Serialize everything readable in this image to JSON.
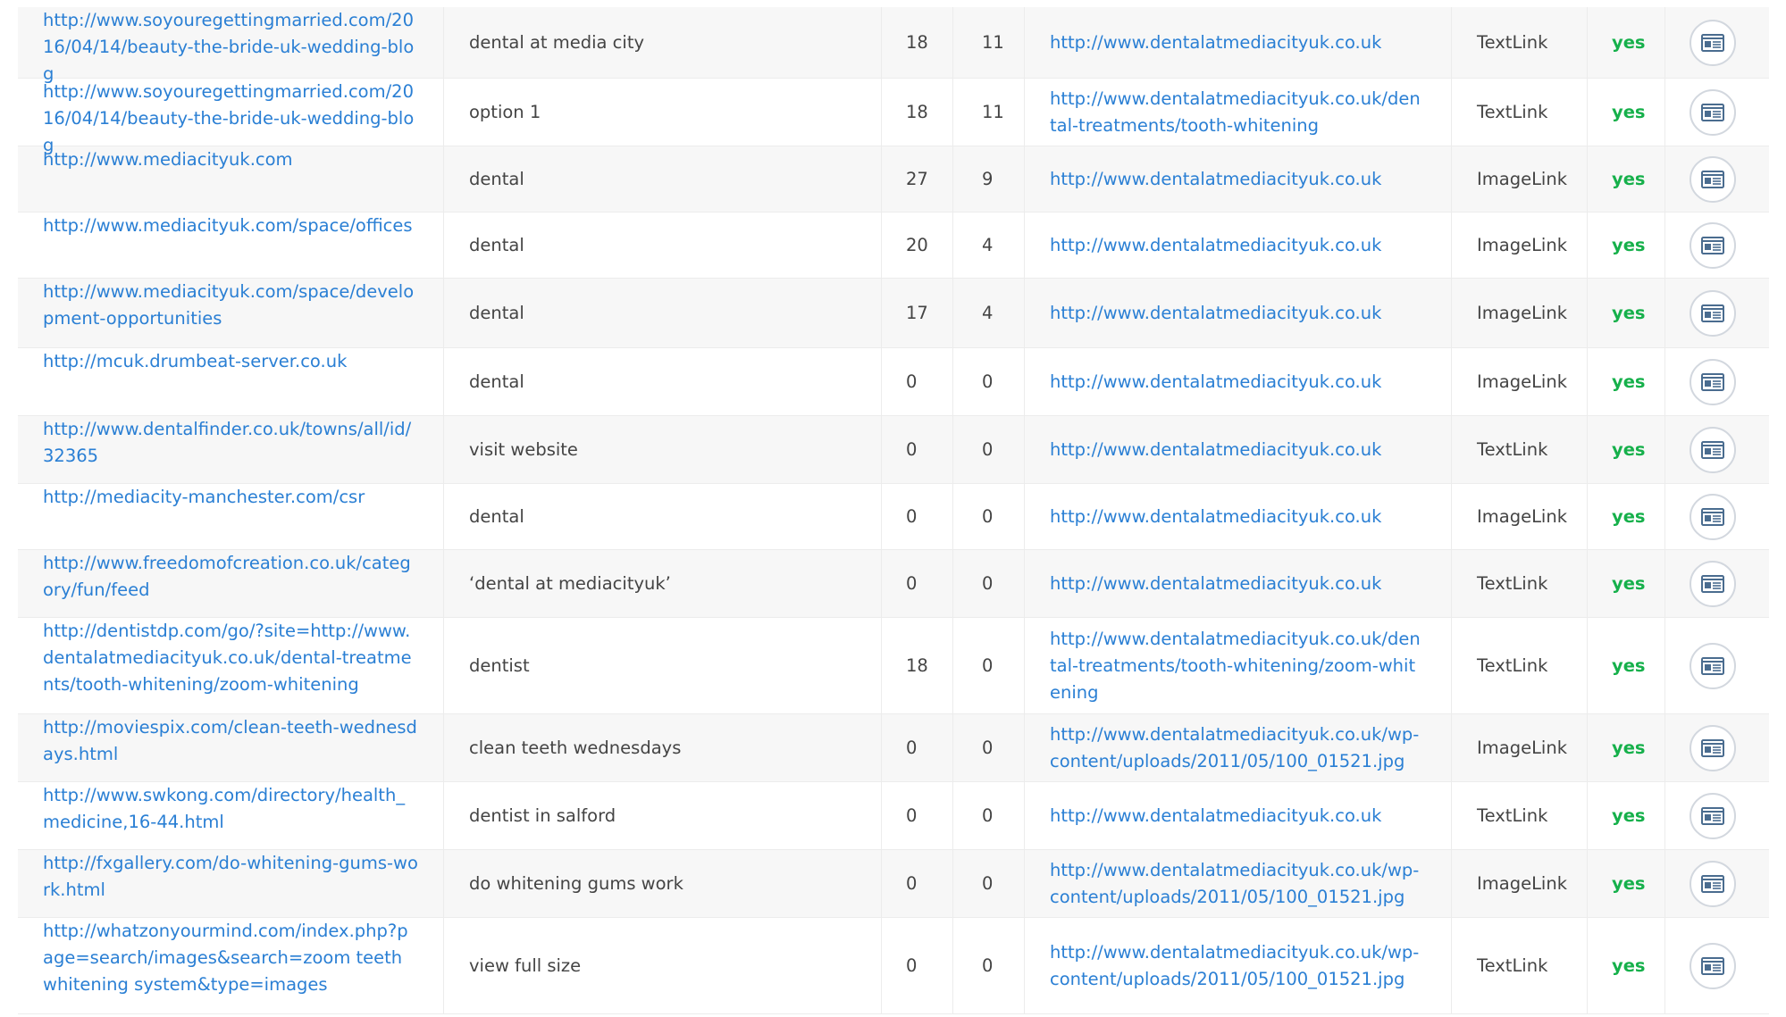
{
  "table": {
    "rows": [
      {
        "source_url": "http://www.soyouregettingmarried.com/2016/04/14/beauty-the-bride-uk-wedding-blog",
        "anchor_text": "dental at media city",
        "metric_1": "18",
        "metric_2": "11",
        "target_url": "http://www.dentalatmediacityuk.co.uk",
        "link_type": "TextLink",
        "status": "yes"
      },
      {
        "source_url": "http://www.soyouregettingmarried.com/2016/04/14/beauty-the-bride-uk-wedding-blog",
        "anchor_text": "option 1",
        "metric_1": "18",
        "metric_2": "11",
        "target_url": "http://www.dentalatmediacityuk.co.uk/dental-treatments/tooth-whitening",
        "link_type": "TextLink",
        "status": "yes"
      },
      {
        "source_url": "http://www.mediacityuk.com",
        "anchor_text": "dental",
        "metric_1": "27",
        "metric_2": "9",
        "target_url": "http://www.dentalatmediacityuk.co.uk",
        "link_type": "ImageLink",
        "status": "yes"
      },
      {
        "source_url": "http://www.mediacityuk.com/space/offices",
        "anchor_text": "dental",
        "metric_1": "20",
        "metric_2": "4",
        "target_url": "http://www.dentalatmediacityuk.co.uk",
        "link_type": "ImageLink",
        "status": "yes"
      },
      {
        "source_url": "http://www.mediacityuk.com/space/development-opportunities",
        "anchor_text": "dental",
        "metric_1": "17",
        "metric_2": "4",
        "target_url": "http://www.dentalatmediacityuk.co.uk",
        "link_type": "ImageLink",
        "status": "yes"
      },
      {
        "source_url": "http://mcuk.drumbeat-server.co.uk",
        "anchor_text": "dental",
        "metric_1": "0",
        "metric_2": "0",
        "target_url": "http://www.dentalatmediacityuk.co.uk",
        "link_type": "ImageLink",
        "status": "yes"
      },
      {
        "source_url": "http://www.dentalfinder.co.uk/towns/all/id/32365",
        "anchor_text": "visit website",
        "metric_1": "0",
        "metric_2": "0",
        "target_url": "http://www.dentalatmediacityuk.co.uk",
        "link_type": "TextLink",
        "status": "yes"
      },
      {
        "source_url": "http://mediacity-manchester.com/csr",
        "anchor_text": "dental",
        "metric_1": "0",
        "metric_2": "0",
        "target_url": "http://www.dentalatmediacityuk.co.uk",
        "link_type": "ImageLink",
        "status": "yes"
      },
      {
        "source_url": "http://www.freedomofcreation.co.uk/category/fun/feed",
        "anchor_text": "‘dental at mediacityuk’",
        "metric_1": "0",
        "metric_2": "0",
        "target_url": "http://www.dentalatmediacityuk.co.uk",
        "link_type": "TextLink",
        "status": "yes"
      },
      {
        "source_url": "http://dentistdp.com/go/?site=http://www.dentalatmediacityuk.co.uk/dental-treatments/tooth-whitening/zoom-whitening",
        "anchor_text": "dentist",
        "metric_1": "18",
        "metric_2": "0",
        "target_url": "http://www.dentalatmediacityuk.co.uk/dental-treatments/tooth-whitening/zoom-whitening",
        "link_type": "TextLink",
        "status": "yes"
      },
      {
        "source_url": "http://moviespix.com/clean-teeth-wednesdays.html",
        "anchor_text": "clean teeth wednesdays",
        "metric_1": "0",
        "metric_2": "0",
        "target_url": "http://www.dentalatmediacityuk.co.uk/wp-content/uploads/2011/05/100_01521.jpg",
        "link_type": "ImageLink",
        "status": "yes"
      },
      {
        "source_url": "http://www.swkong.com/directory/health_medicine,16-44.html",
        "anchor_text": "dentist in salford",
        "metric_1": "0",
        "metric_2": "0",
        "target_url": "http://www.dentalatmediacityuk.co.uk",
        "link_type": "TextLink",
        "status": "yes"
      },
      {
        "source_url": "http://fxgallery.com/do-whitening-gums-work.html",
        "anchor_text": "do whitening gums work",
        "metric_1": "0",
        "metric_2": "0",
        "target_url": "http://www.dentalatmediacityuk.co.uk/wp-content/uploads/2011/05/100_01521.jpg",
        "link_type": "ImageLink",
        "status": "yes"
      },
      {
        "source_url": "http://whatzonyourmind.com/index.php?page=search/images&search=zoom teeth whitening system&type=images",
        "anchor_text": "view full size",
        "metric_1": "0",
        "metric_2": "0",
        "target_url": "http://www.dentalatmediacityuk.co.uk/wp-content/uploads/2011/05/100_01521.jpg",
        "link_type": "TextLink",
        "status": "yes"
      }
    ],
    "action_icon": "details-icon"
  },
  "colors": {
    "link": "#2a7fd4",
    "status_yes": "#16b04b",
    "row_alt": "#f7f7f7",
    "text": "#444444"
  }
}
